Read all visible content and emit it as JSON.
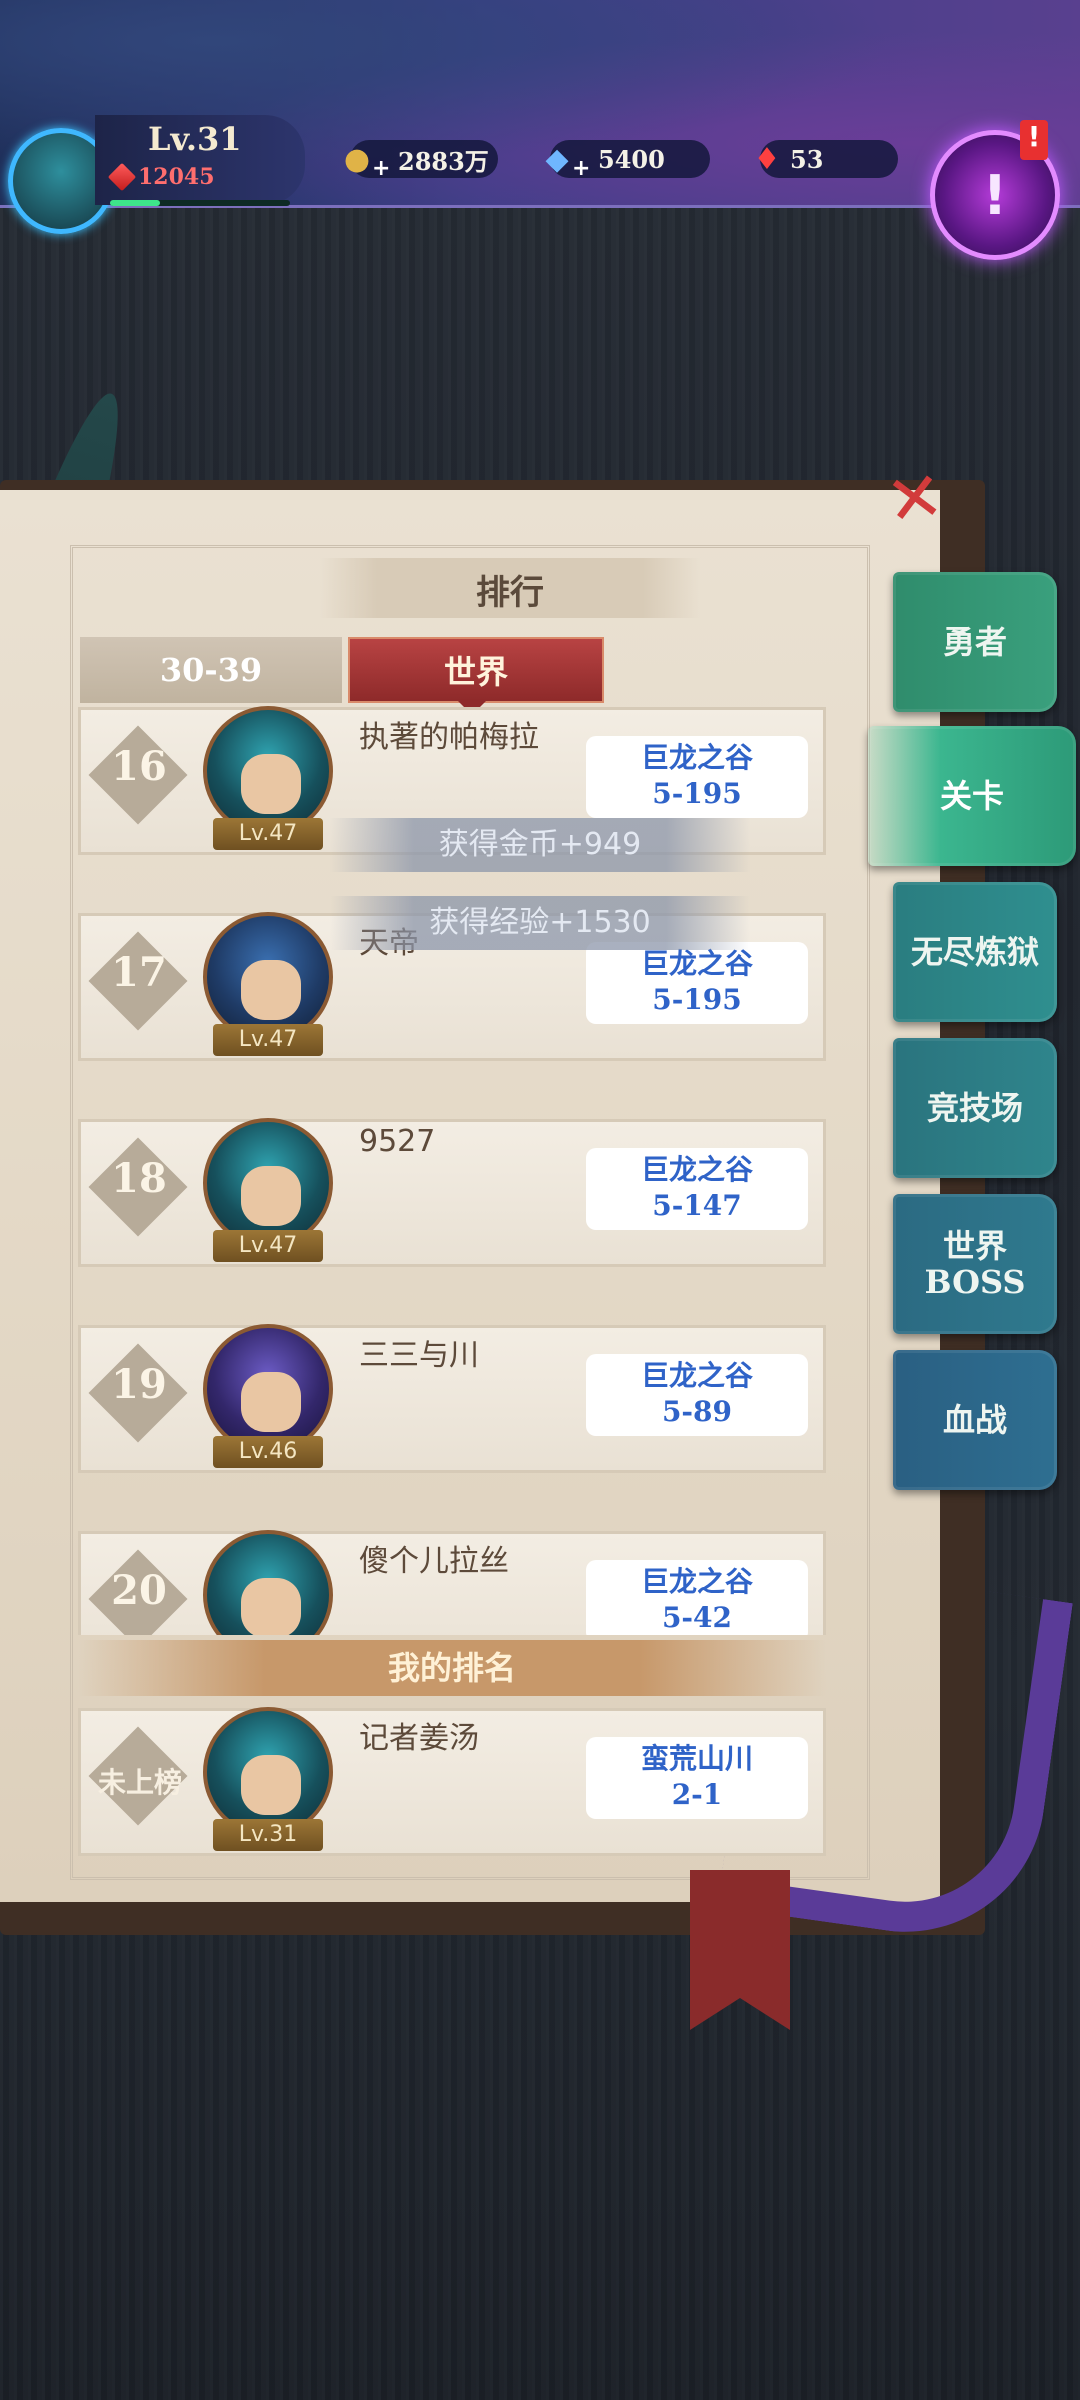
{
  "player": {
    "level": "Lv.31",
    "power": "12045",
    "exp_fraction": 0.28
  },
  "resources": [
    {
      "icon": "gold-coin-icon",
      "value": "2883万"
    },
    {
      "icon": "diamond-icon",
      "value": "5400"
    },
    {
      "icon": "red-crystal-icon",
      "value": "53"
    }
  ],
  "quest_button": {
    "icon": "quest-scroll-icon",
    "alert": "!"
  },
  "leaderboard": {
    "title": "排行",
    "range_tab": "30-39",
    "world_tab": "世界",
    "close_icon": "close-x-icon"
  },
  "side_tabs": [
    "勇者",
    "关卡",
    "无尽炼狱",
    "竞技场",
    "世界\nBOSS",
    "血战"
  ],
  "active_side_tab": "关卡",
  "rows": [
    {
      "rank": "16",
      "level": "Lv.47",
      "name": "执著的帕梅拉",
      "stage_name": "巨龙之谷",
      "stage": "5-195"
    },
    {
      "rank": "17",
      "level": "Lv.47",
      "name": "天帝",
      "stage_name": "巨龙之谷",
      "stage": "5-195"
    },
    {
      "rank": "18",
      "level": "Lv.47",
      "name": "9527",
      "stage_name": "巨龙之谷",
      "stage": "5-147"
    },
    {
      "rank": "19",
      "level": "Lv.46",
      "name": "三三与川",
      "stage_name": "巨龙之谷",
      "stage": "5-89"
    },
    {
      "rank": "20",
      "level": "",
      "name": "傻个儿拉丝",
      "stage_name": "巨龙之谷",
      "stage": "5-42"
    }
  ],
  "my_rank": {
    "label": "我的排名",
    "rank": "未上榜",
    "level": "Lv.31",
    "name": "记者姜汤",
    "stage_name": "蛮荒山川",
    "stage": "2-1"
  },
  "notifications": [
    "获得金币+949",
    "获得经验+1530"
  ],
  "colors": {
    "active_tab": "#3bb68f",
    "world_tab": "#b84343",
    "stage_text": "#2f63c8"
  }
}
